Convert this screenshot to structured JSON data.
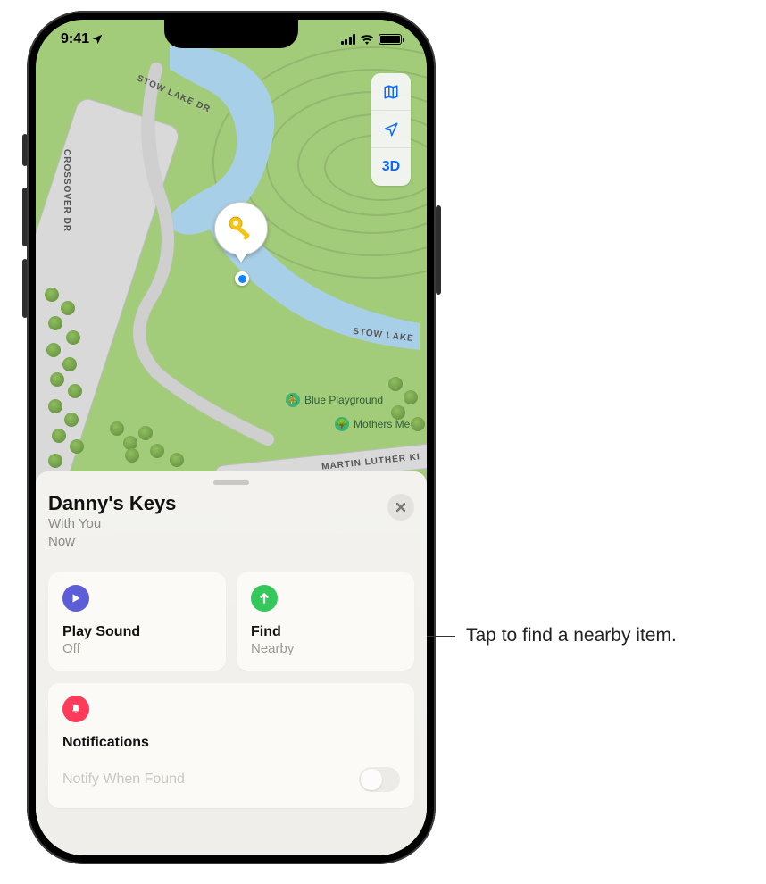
{
  "status": {
    "time": "9:41"
  },
  "map": {
    "controls": {
      "mode3d": "3D"
    },
    "roads": {
      "stow_lake_dr_top": "STOW LAKE DR",
      "crossover_dr": "CROSSOVER DR",
      "stow_lake_dr_right": "STOW LAKE",
      "mlk": "MARTIN LUTHER KI"
    },
    "poi": {
      "blue_playground": "Blue Playground",
      "mothers_me": "Mothers Me"
    }
  },
  "item": {
    "name": "Danny's Keys",
    "status_line1": "With You",
    "status_line2": "Now"
  },
  "actions": {
    "play_sound": {
      "title": "Play Sound",
      "sub": "Off"
    },
    "find": {
      "title": "Find",
      "sub": "Nearby"
    }
  },
  "notifications": {
    "header": "Notifications",
    "notify_when_found": "Notify When Found"
  },
  "callout": "Tap to find a nearby item."
}
